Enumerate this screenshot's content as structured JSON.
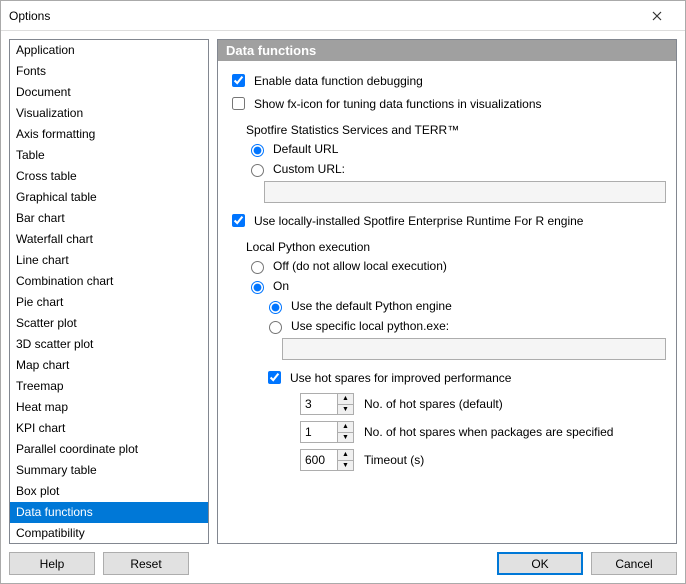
{
  "window": {
    "title": "Options"
  },
  "sidebar": {
    "items": [
      "Application",
      "Fonts",
      "Document",
      "Visualization",
      "Axis formatting",
      "Table",
      "Cross table",
      "Graphical table",
      "Bar chart",
      "Waterfall chart",
      "Line chart",
      "Combination chart",
      "Pie chart",
      "Scatter plot",
      "3D scatter plot",
      "Map chart",
      "Treemap",
      "Heat map",
      "KPI chart",
      "Parallel coordinate plot",
      "Summary table",
      "Box plot",
      "Data functions",
      "Compatibility"
    ],
    "selected_index": 22
  },
  "left_buttons": {
    "help": "Help",
    "reset": "Reset"
  },
  "panel": {
    "title": "Data functions",
    "enable_debugging": {
      "label": "Enable data function debugging",
      "checked": true
    },
    "show_fx_icon": {
      "label": "Show fx-icon for tuning data functions in visualizations",
      "checked": false
    },
    "stats_group": "Spotfire Statistics Services and TERR™",
    "url_mode": {
      "default": "Default URL",
      "custom": "Custom URL:",
      "selected": "default",
      "custom_value": ""
    },
    "use_local_terr": {
      "label": "Use locally-installed Spotfire Enterprise Runtime For R engine",
      "checked": true
    },
    "python_group": "Local Python execution",
    "python_mode": {
      "off": "Off (do not allow local execution)",
      "on": "On",
      "selected": "on"
    },
    "python_engine": {
      "default": "Use the default Python engine",
      "specific": "Use specific local python.exe:",
      "selected": "default",
      "specific_value": ""
    },
    "hot_spares": {
      "label": "Use hot spares for improved performance",
      "checked": true,
      "default_count": {
        "value": "3",
        "label": "No. of hot spares (default)"
      },
      "pkg_count": {
        "value": "1",
        "label": "No. of hot spares when packages are specified"
      },
      "timeout": {
        "value": "600",
        "label": "Timeout (s)"
      }
    }
  },
  "dialog_buttons": {
    "ok": "OK",
    "cancel": "Cancel"
  }
}
